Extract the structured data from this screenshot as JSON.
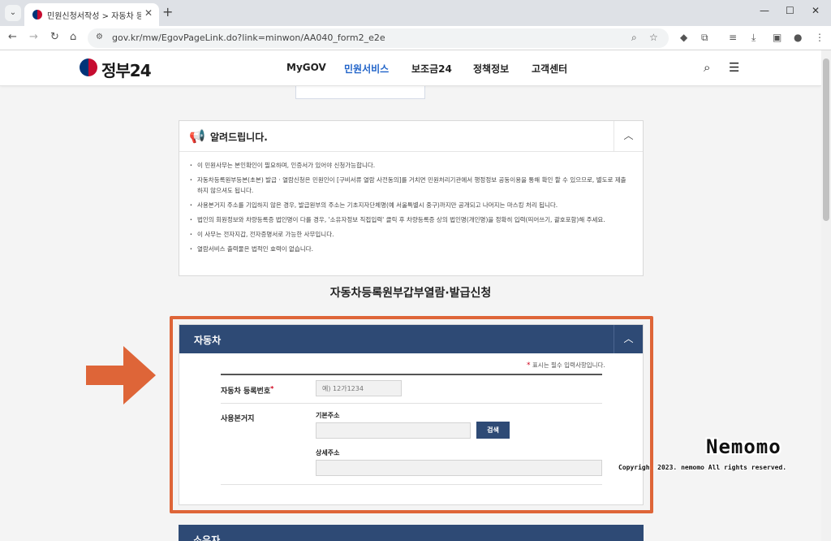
{
  "browser": {
    "tab_title": "민원신청서작성 > 자동차 등록",
    "tab_close": "✕",
    "new_tab": "+",
    "url": "gov.kr/mw/EgovPageLink.do?link=minwon/AA040_form2_e2e",
    "window_controls": [
      "—",
      "☐",
      "✕"
    ]
  },
  "site": {
    "logo_text": "정부24",
    "nav": [
      {
        "label": "MyGOV",
        "active": false
      },
      {
        "label": "민원서비스",
        "active": true
      },
      {
        "label": "보조금24",
        "active": false
      },
      {
        "label": "정책정보",
        "active": false
      },
      {
        "label": "고객센터",
        "active": false
      }
    ]
  },
  "notice": {
    "title": "알려드립니다.",
    "items": [
      "이 민원사무는 본인확인이 필요하며, 인증서가 있어야 신청가능합니다.",
      "자동차등록원부등본(초본) 발급 · 열람신청은 민원인이 [구비서류 열람 사전동의]를 거치면 민원처리기관에서 행정정보 공동이용을 통해 확인 할 수 있으므로, 별도로 제출하지 않으셔도 됩니다.",
      "사용본거지 주소를 기입하지 않은 경우, 발급원부의 주소는 기초지자단체명(예 서울특별시 중구)까지만 공개되고 나머지는 마스킹 처리 됩니다.",
      "법인의 회원정보와 차량등록증 법인명이 다를 경우, '소유자정보 직접입력' 클릭 후 차량등록증 상의 법인명(개인명)을 정확히 입력(띄어쓰기, 괄호포함)해 주세요.",
      "이 사무는 전자지갑, 전자증명서로 가능한 사무입니다.",
      "열람서비스 출력물은 법적인 효력이 없습니다."
    ]
  },
  "form_title": "자동차등록원부갑부열람·발급신청",
  "section": {
    "title": "자동차",
    "required_note": "표시는 필수 입력사항입니다.",
    "reg_number_label": "자동차 등록번호",
    "reg_number_placeholder": "예) 12가1234",
    "address_label": "사용본거지",
    "basic_address_label": "기본주소",
    "search_label": "검색",
    "detail_address_label": "상세주소"
  },
  "section2": {
    "title": "소유자"
  },
  "watermark": {
    "title": "Nemomo",
    "copyright": "Copyright 2023. nemomo All rights reserved."
  },
  "colors": {
    "brand_navy": "#2e4a75",
    "highlight_orange": "#de6538",
    "nav_active": "#2164c9",
    "required_red": "#d0021b"
  },
  "icons": {
    "tab_favicon": "taegeuk-icon",
    "notice": "megaphone-icon",
    "collapse": "chevron-up-icon",
    "header_search": "search-icon",
    "header_menu": "hamburger-menu-icon",
    "annotation": "arrow-right-icon"
  }
}
